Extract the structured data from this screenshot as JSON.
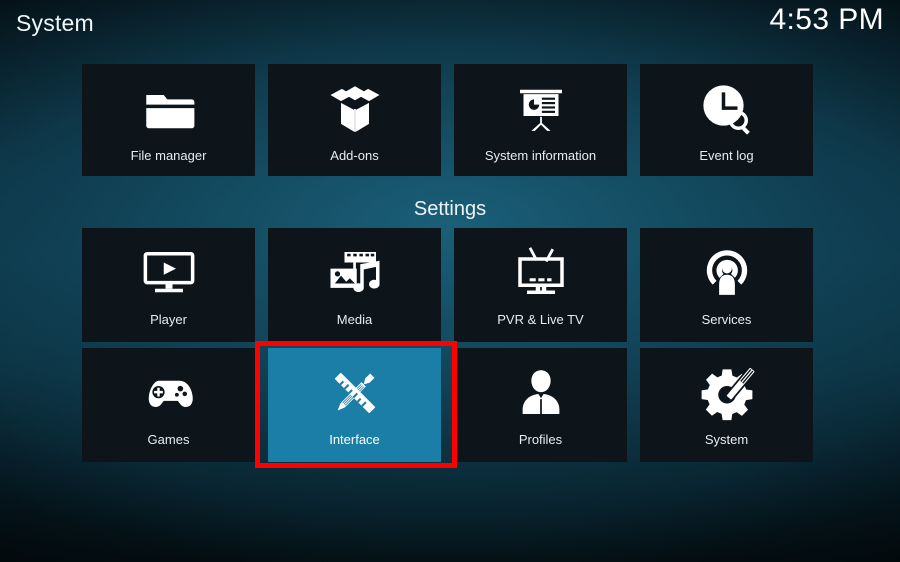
{
  "header": {
    "title": "System",
    "clock": "4:53 PM"
  },
  "section": {
    "settings_heading": "Settings"
  },
  "colors": {
    "selected_tile": "#1b7ea6",
    "tile_background": "#0e151a",
    "annotation_border": "#ff0000",
    "label_text": "#e6edf0"
  },
  "rows": [
    {
      "name": "utilities-row",
      "tiles": [
        {
          "label": "File manager",
          "icon": "folder-icon",
          "selected": false
        },
        {
          "label": "Add-ons",
          "icon": "open-box-icon",
          "selected": false
        },
        {
          "label": "System information",
          "icon": "presentation-icon",
          "selected": false
        },
        {
          "label": "Event log",
          "icon": "clock-search-icon",
          "selected": false
        }
      ]
    },
    {
      "name": "settings-row-1",
      "tiles": [
        {
          "label": "Player",
          "icon": "monitor-play-icon",
          "selected": false
        },
        {
          "label": "Media",
          "icon": "media-library-icon",
          "selected": false
        },
        {
          "label": "PVR & Live TV",
          "icon": "television-icon",
          "selected": false
        },
        {
          "label": "Services",
          "icon": "broadcast-user-icon",
          "selected": false
        }
      ]
    },
    {
      "name": "settings-row-2",
      "tiles": [
        {
          "label": "Games",
          "icon": "gamepad-icon",
          "selected": false
        },
        {
          "label": "Interface",
          "icon": "pencil-ruler-icon",
          "selected": true
        },
        {
          "label": "Profiles",
          "icon": "user-bust-icon",
          "selected": false
        },
        {
          "label": "System",
          "icon": "gear-wrench-icon",
          "selected": false
        }
      ]
    }
  ]
}
